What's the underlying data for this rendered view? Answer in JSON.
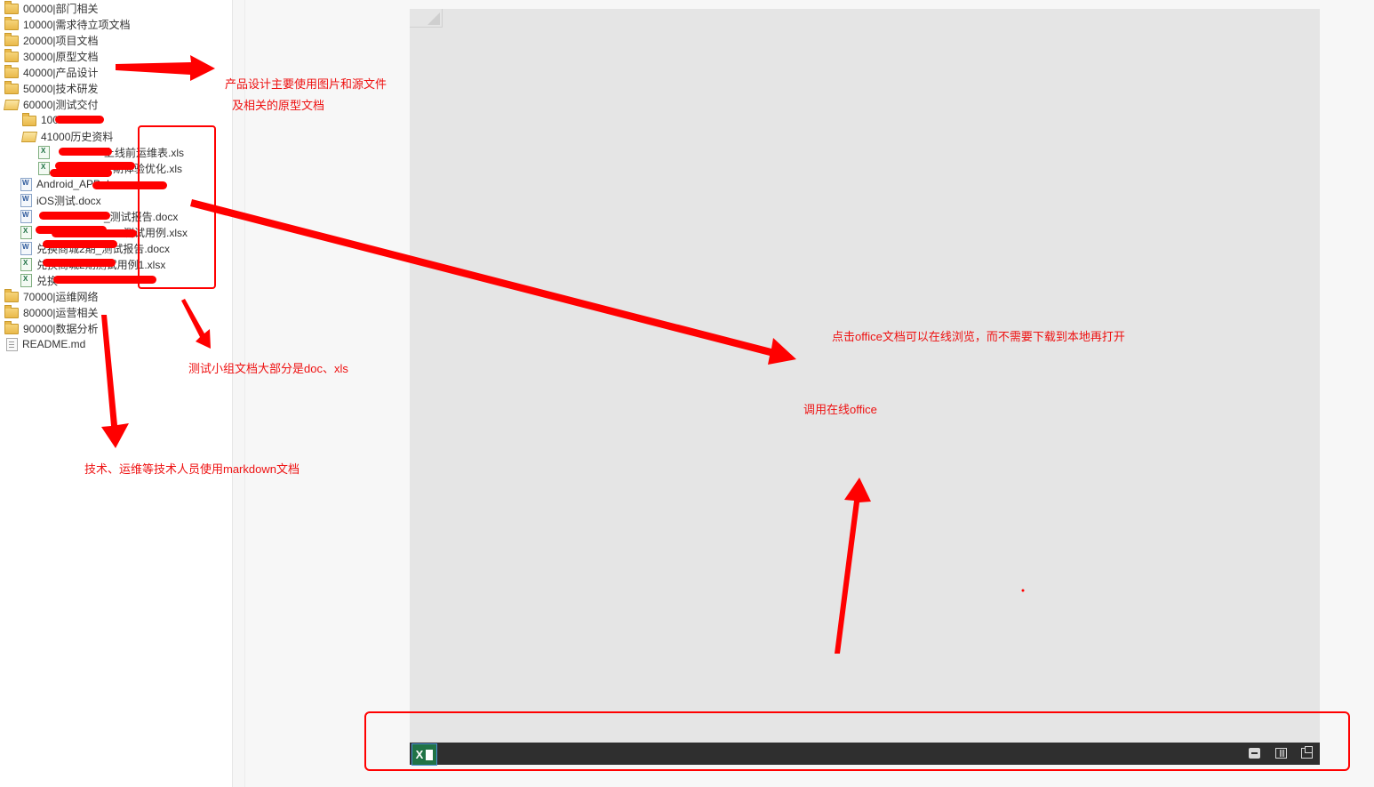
{
  "sidebar": {
    "items": [
      {
        "label": "00000|部门相关",
        "icon": "folder-icon"
      },
      {
        "label": "10000|需求待立项文档",
        "icon": "folder-icon"
      },
      {
        "label": "20000|项目文档",
        "icon": "folder-icon"
      },
      {
        "label": "30000|原型文档",
        "icon": "folder-icon"
      },
      {
        "label": "40000|产品设计",
        "icon": "folder-icon"
      },
      {
        "label": "50000|技术研发",
        "icon": "folder-icon"
      },
      {
        "label": "60000|测试交付",
        "icon": "folder-open-icon"
      },
      {
        "label": "100",
        "icon": "folder-icon"
      },
      {
        "label": "41000历史资料",
        "icon": "folder-open-icon"
      },
      {
        "label": "上线前运维表.xls",
        "icon": "excel-icon"
      },
      {
        "label": "期体验优化.xls",
        "icon": "excel-icon"
      },
      {
        "label": "Android_APP docx",
        "icon": "word-icon"
      },
      {
        "label": "iOS测试.docx",
        "icon": "word-icon"
      },
      {
        "label": "_测试报告.docx",
        "icon": "word-icon"
      },
      {
        "label": "测试用例.xlsx",
        "icon": "excel-icon"
      },
      {
        "label": "兑换商城2期_测试报告.docx",
        "icon": "word-icon"
      },
      {
        "label": "兑换商城2期测试用例1.xlsx",
        "icon": "excel-icon"
      },
      {
        "label": "兑换",
        "icon": "excel-icon"
      },
      {
        "label": "70000|运维网络",
        "icon": "folder-icon"
      },
      {
        "label": "80000|运营相关",
        "icon": "folder-icon"
      },
      {
        "label": "90000|数据分析",
        "icon": "folder-icon"
      },
      {
        "label": "README.md",
        "icon": "md-icon"
      }
    ]
  },
  "annotations": {
    "product_design_line1": "产品设计主要使用图片和源文件",
    "product_design_line2": "及相关的原型文档",
    "test_docs": "测试小组文档大部分是doc、xls",
    "tech_markdown": "技术、运维等技术人员使用markdown文档",
    "office_preview": "点击office文档可以在线浏览，而不需要下载到本地再打开",
    "office_online": "调用在线office"
  },
  "viewer": {
    "statusbar": {
      "app_icon": "excel-icon",
      "app_glyph": "X",
      "buttons": [
        "print-icon",
        "reading-view-icon",
        "popout-icon"
      ]
    }
  },
  "colors": {
    "annotation_red": "#ee1111",
    "statusbar": "#2f2f2f",
    "viewer_bg": "#e5e5e5",
    "excel_green": "#217346"
  }
}
